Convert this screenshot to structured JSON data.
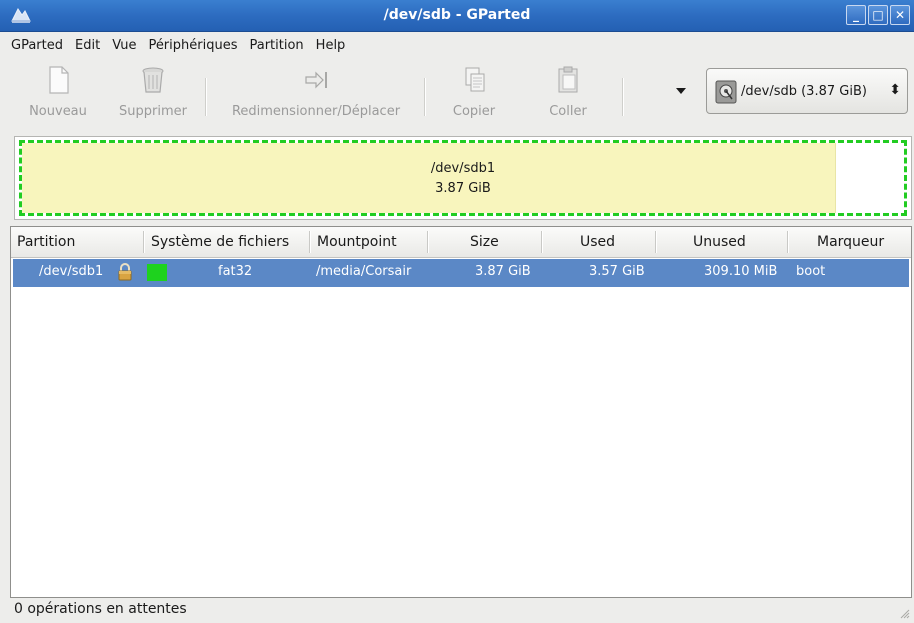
{
  "window": {
    "title": "/dev/sdb - GParted",
    "buttons": [
      "minimize-icon",
      "maximize-icon",
      "close-icon"
    ]
  },
  "menu": [
    "GParted",
    "Edit",
    "Vue",
    "Périphériques",
    "Partition",
    "Help"
  ],
  "toolbar": {
    "new_label": "Nouveau",
    "delete_label": "Supprimer",
    "resize_label": "Redimensionner/Déplacer",
    "copy_label": "Copier",
    "paste_label": "Coller",
    "device_combo": "/dev/sdb  (3.87 GiB)"
  },
  "partition_map": {
    "name": "/dev/sdb1",
    "size": "3.87 GiB",
    "used_fraction": 0.923
  },
  "list": {
    "columns": [
      "Partition",
      "Système de fichiers",
      "Mountpoint",
      "Size",
      "Used",
      "Unused",
      "Marqueur"
    ],
    "rows": [
      {
        "partition": "/dev/sdb1",
        "filesystem": "fat32",
        "fs_color": "#1ed21e",
        "mountpoint": "/media/Corsair",
        "size": "3.87 GiB",
        "used": "3.57 GiB",
        "unused": "309.10 MiB",
        "flags": "boot",
        "locked": true
      }
    ]
  },
  "status": {
    "text": "0 opérations en attentes"
  },
  "colors": {
    "titlebar": "#2d6cc0",
    "selection": "#5b88c6",
    "partition_used": "#f8f5bd",
    "partition_border": "#22cc22"
  }
}
